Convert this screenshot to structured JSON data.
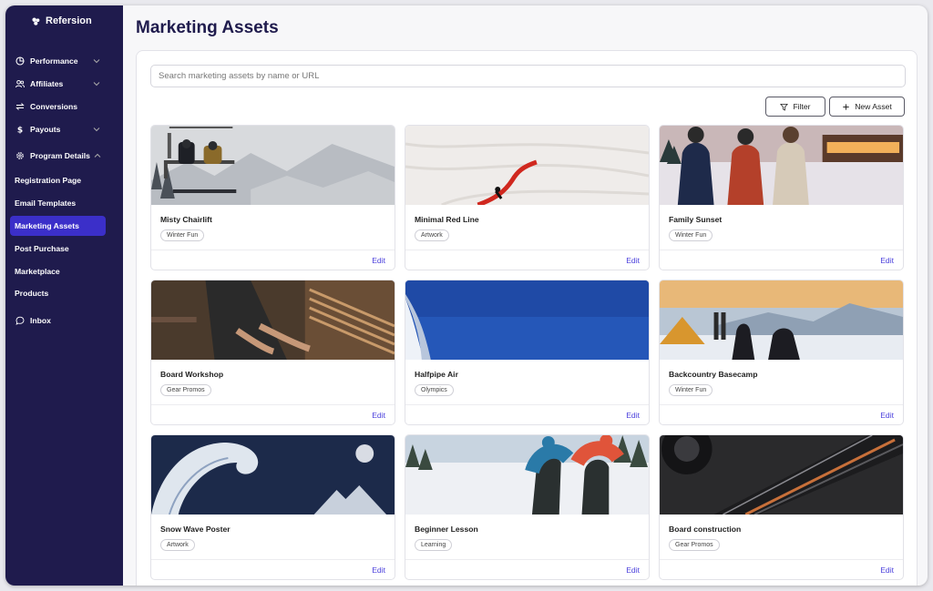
{
  "brand": {
    "name": "Refersion"
  },
  "sidebar": {
    "items": [
      {
        "label": "Performance",
        "icon": "chart-pie-icon",
        "chevron": "down"
      },
      {
        "label": "Affiliates",
        "icon": "users-icon",
        "chevron": "down"
      },
      {
        "label": "Conversions",
        "icon": "arrows-exchange-icon",
        "chevron": ""
      },
      {
        "label": "Payouts",
        "icon": "dollar-icon",
        "chevron": "down"
      },
      {
        "label": "Program Details",
        "icon": "gear-icon",
        "chevron": "up"
      },
      {
        "label": "Registration Page"
      },
      {
        "label": "Email Templates"
      },
      {
        "label": "Marketing Assets",
        "active": true
      },
      {
        "label": "Post Purchase"
      },
      {
        "label": "Marketplace"
      },
      {
        "label": "Products"
      },
      {
        "label": "Inbox",
        "icon": "chat-bubble-icon"
      }
    ]
  },
  "main": {
    "title": "Marketing Assets",
    "search": {
      "placeholder": "Search marketing assets by name or URL",
      "value": ""
    },
    "filter_label": "Filter",
    "new_asset_label": "New Asset",
    "edit_label": "Edit",
    "assets": [
      {
        "title": "Misty Chairlift",
        "tag": "Winter Fun",
        "image": "chairlift"
      },
      {
        "title": "Minimal Red Line",
        "tag": "Artwork",
        "image": "red-line"
      },
      {
        "title": "Family Sunset",
        "tag": "Winter Fun",
        "image": "family"
      },
      {
        "title": "Board Workshop",
        "tag": "Gear Promos",
        "image": "workshop"
      },
      {
        "title": "Halfpipe Air",
        "tag": "Olympics",
        "image": "halfpipe"
      },
      {
        "title": "Backcountry Basecamp",
        "tag": "Winter Fun",
        "image": "basecamp"
      },
      {
        "title": "Snow Wave Poster",
        "tag": "Artwork",
        "image": "wave"
      },
      {
        "title": "Beginner Lesson",
        "tag": "Learning",
        "image": "lesson"
      },
      {
        "title": "Board construction",
        "tag": "Gear Promos",
        "image": "construction"
      }
    ]
  },
  "colors": {
    "sidebar": "#1f1b4d",
    "active": "#3b2fc9",
    "link": "#4a3fdc"
  }
}
